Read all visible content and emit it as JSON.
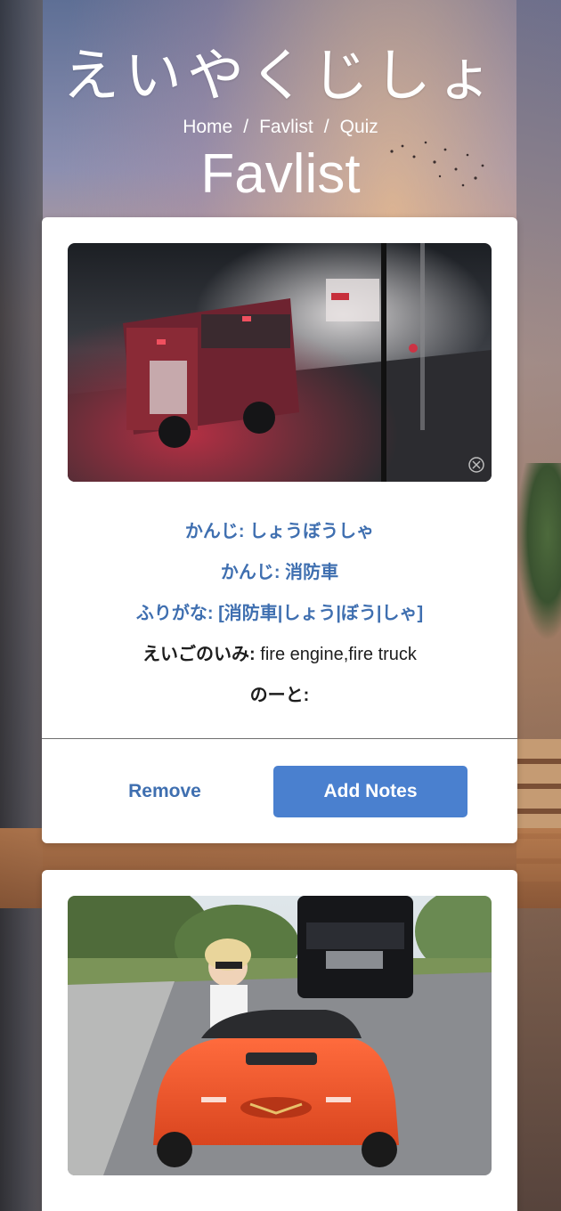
{
  "header": {
    "app_title": "えいやくじしょ",
    "breadcrumb": [
      {
        "label": "Home"
      },
      {
        "label": "Favlist"
      },
      {
        "label": "Quiz"
      }
    ],
    "breadcrumb_separator": "/",
    "page_title": "Favlist"
  },
  "cards": [
    {
      "image": "fire-truck-gif",
      "reading_label": "かんじ:",
      "reading_value": "しょうぼうしゃ",
      "kanji_label": "かんじ:",
      "kanji_value": "消防車",
      "furigana_label": "ふりがな:",
      "furigana_value": "[消防車|しょう|ぼう|しゃ]",
      "meaning_label": "えいごのいみ:",
      "meaning_value": "fire engine,fire truck",
      "notes_label": "のーと:",
      "notes_value": "",
      "remove_label": "Remove",
      "add_notes_label": "Add Notes"
    },
    {
      "image": "toy-car-gif"
    }
  ],
  "colors": {
    "accent": "#4a80cf",
    "link_text": "#3f6fb0",
    "card_bg": "#ffffff"
  }
}
